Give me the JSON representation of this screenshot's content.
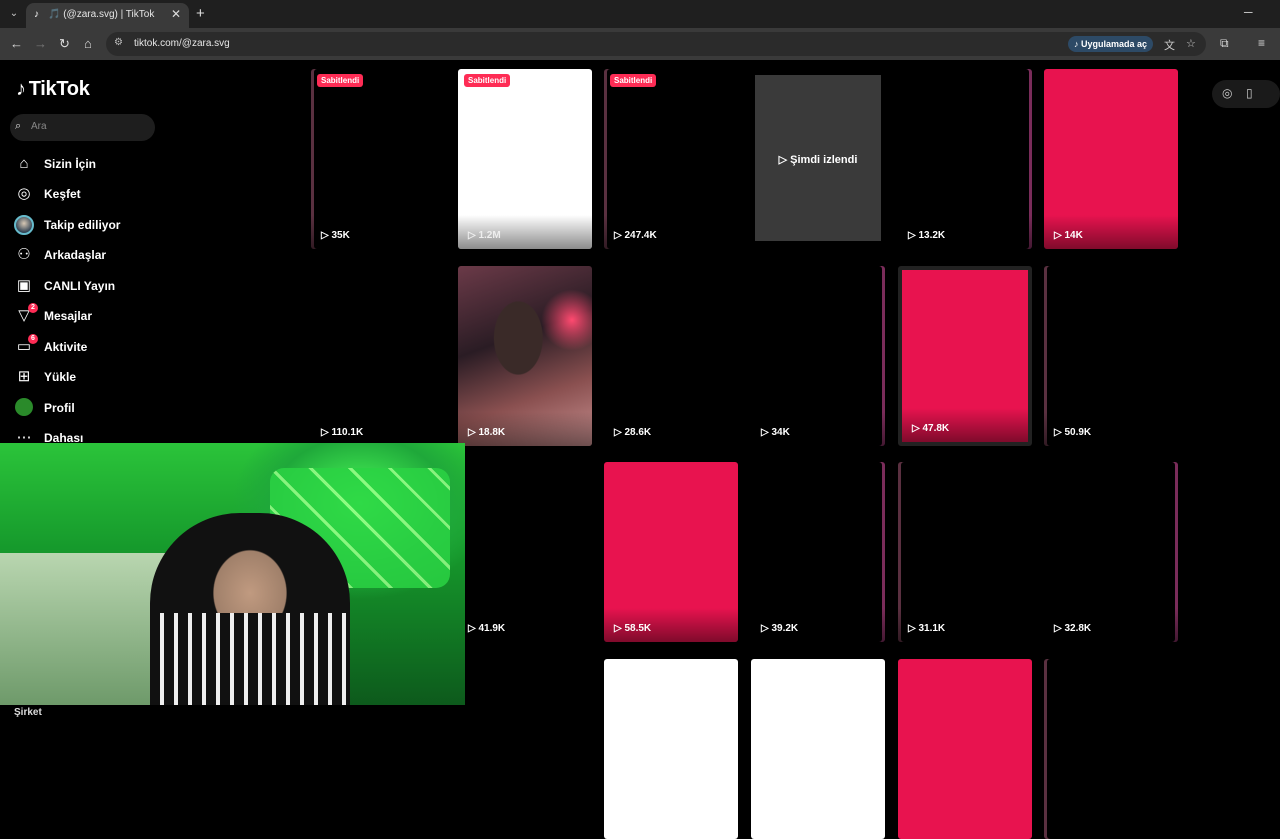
{
  "browser": {
    "tab_title": "🎵 (@zara.svg) | TikTok",
    "url": "tiktok.com/@zara.svg",
    "open_in_app": "Uygulamada aç",
    "new_tab": "+",
    "close": "✕",
    "back": "←",
    "forward": "→",
    "reload": "↻",
    "home": "⌂"
  },
  "tiktok": {
    "logo": "TikTok",
    "search_placeholder": "Ara",
    "nav": [
      {
        "label": "Sizin İçin",
        "icon": "home-icon"
      },
      {
        "label": "Keşfet",
        "icon": "compass-icon"
      },
      {
        "label": "Takip ediliyor",
        "icon": "avatar-icon"
      },
      {
        "label": "Arkadaşlar",
        "icon": "friends-icon"
      },
      {
        "label": "CANLI Yayın",
        "icon": "live-icon"
      },
      {
        "label": "Mesajlar",
        "icon": "messages-icon",
        "badge": "2"
      },
      {
        "label": "Aktivite",
        "icon": "activity-icon",
        "badge": "6"
      },
      {
        "label": "Yükle",
        "icon": "upload-icon"
      },
      {
        "label": "Profil",
        "icon": "profile-avatar-icon"
      },
      {
        "label": "Dahası",
        "icon": "more-icon"
      }
    ],
    "footer": "Şirket"
  },
  "grid": {
    "pinned_label": "Sabitlendi",
    "watched_label": "Şimdi izlendi",
    "row1": [
      "35K",
      "1.2M",
      "247.4K",
      "",
      "13.2K",
      "14K"
    ],
    "row2": [
      "110.1K",
      "18.8K",
      "28.6K",
      "34K",
      "47.8K",
      "50.9K"
    ],
    "row3": [
      "41.9K",
      "58.5K",
      "39.2K",
      "31.1K",
      "32.8K"
    ]
  }
}
